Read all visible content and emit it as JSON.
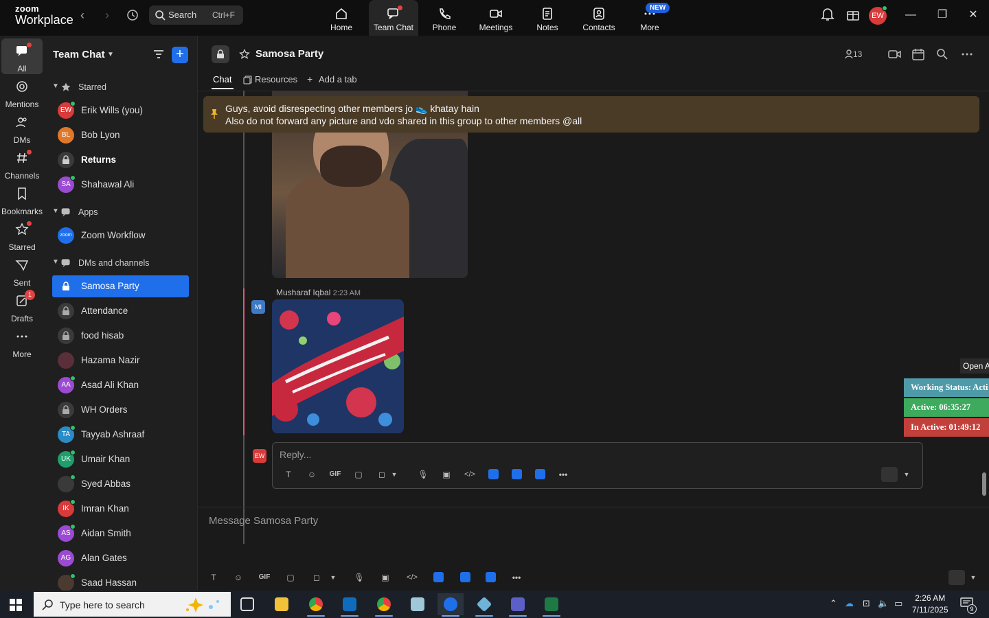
{
  "titlebar": {
    "logo_top": "zoom",
    "logo_bottom": "Workplace",
    "search_label": "Search",
    "search_shortcut": "Ctrl+F",
    "nav": [
      {
        "label": "Home",
        "icon": "home-icon"
      },
      {
        "label": "Team Chat",
        "icon": "chat-icon"
      },
      {
        "label": "Phone",
        "icon": "phone-icon"
      },
      {
        "label": "Meetings",
        "icon": "video-icon"
      },
      {
        "label": "Notes",
        "icon": "notes-icon"
      },
      {
        "label": "Contacts",
        "icon": "contacts-icon"
      },
      {
        "label": "More",
        "icon": "more-icon"
      }
    ],
    "new_badge": "NEW",
    "user_initials": "EW"
  },
  "rail": {
    "items": [
      {
        "label": "All"
      },
      {
        "label": "Mentions"
      },
      {
        "label": "DMs"
      },
      {
        "label": "Channels"
      },
      {
        "label": "Bookmarks"
      },
      {
        "label": "Starred"
      },
      {
        "label": "Sent"
      },
      {
        "label": "Drafts",
        "badge": "1"
      },
      {
        "label": "More"
      }
    ]
  },
  "sidebar": {
    "title": "Team Chat",
    "sections": {
      "starred": "Starred",
      "apps": "Apps",
      "dms": "DMs and channels"
    },
    "starred": [
      {
        "name": "Erik Wills (you)",
        "initials": "EW",
        "color": "#d93a3a"
      },
      {
        "name": "Bob Lyon",
        "initials": "BL",
        "color": "#e0782a"
      },
      {
        "name": "Returns",
        "lock": true
      },
      {
        "name": "Shahawal Ali",
        "initials": "SA",
        "color": "#9b4bd1"
      }
    ],
    "apps": [
      {
        "name": "Zoom Workflow",
        "initials": "zoom",
        "color": "#1f6feb"
      }
    ],
    "dms": [
      {
        "name": "Samosa Party",
        "lock": true,
        "selected": true
      },
      {
        "name": "Attendance",
        "lock": true
      },
      {
        "name": "food hisab",
        "lock": true
      },
      {
        "name": "Hazama Nazir",
        "initials": "",
        "color": "#5a2f3a"
      },
      {
        "name": "Asad Ali Khan",
        "initials": "AA",
        "color": "#9b4bd1"
      },
      {
        "name": "WH Orders",
        "lock": true
      },
      {
        "name": "Tayyab Ashraaf",
        "initials": "TA",
        "color": "#2a8cc7"
      },
      {
        "name": "Umair Khan",
        "initials": "UK",
        "color": "#1f9e6b"
      },
      {
        "name": "Syed Abbas",
        "initials": "",
        "color": "#3a3a3a"
      },
      {
        "name": "Imran Khan",
        "initials": "IK",
        "color": "#d93a3a"
      },
      {
        "name": "Aidan Smith",
        "initials": "AS",
        "color": "#9b4bd1"
      },
      {
        "name": "Alan Gates",
        "initials": "AG",
        "color": "#9b4bd1"
      },
      {
        "name": "Saad Hassan",
        "initials": "",
        "color": "#4a3a30"
      }
    ]
  },
  "channel": {
    "title": "Samosa Party",
    "members": "13",
    "tabs": [
      "Chat",
      "Resources",
      "Add a tab"
    ],
    "pinned_line1": "Guys, avoid disrespecting other members jo 👟 khatay hain",
    "pinned_line2": "Also do not forward any picture and vdo shared in this group to other members @all",
    "message_sender": "Musharaf Iqbal",
    "message_time": "2:23 AM",
    "sender_initials": "MI",
    "reply_initials": "EW",
    "reply_placeholder": "Reply...",
    "compose_placeholder": "Message Samosa Party",
    "gif_label": "GIF"
  },
  "overlay": {
    "open_label": "Open A",
    "working_status": "Working Status: Acti",
    "active": "Active: 06:35:27",
    "inactive": "In Active: 01:49:12"
  },
  "taskbar": {
    "search_placeholder": "Type here to search",
    "time": "2:26 AM",
    "date": "7/11/2025",
    "notifications": "9"
  }
}
